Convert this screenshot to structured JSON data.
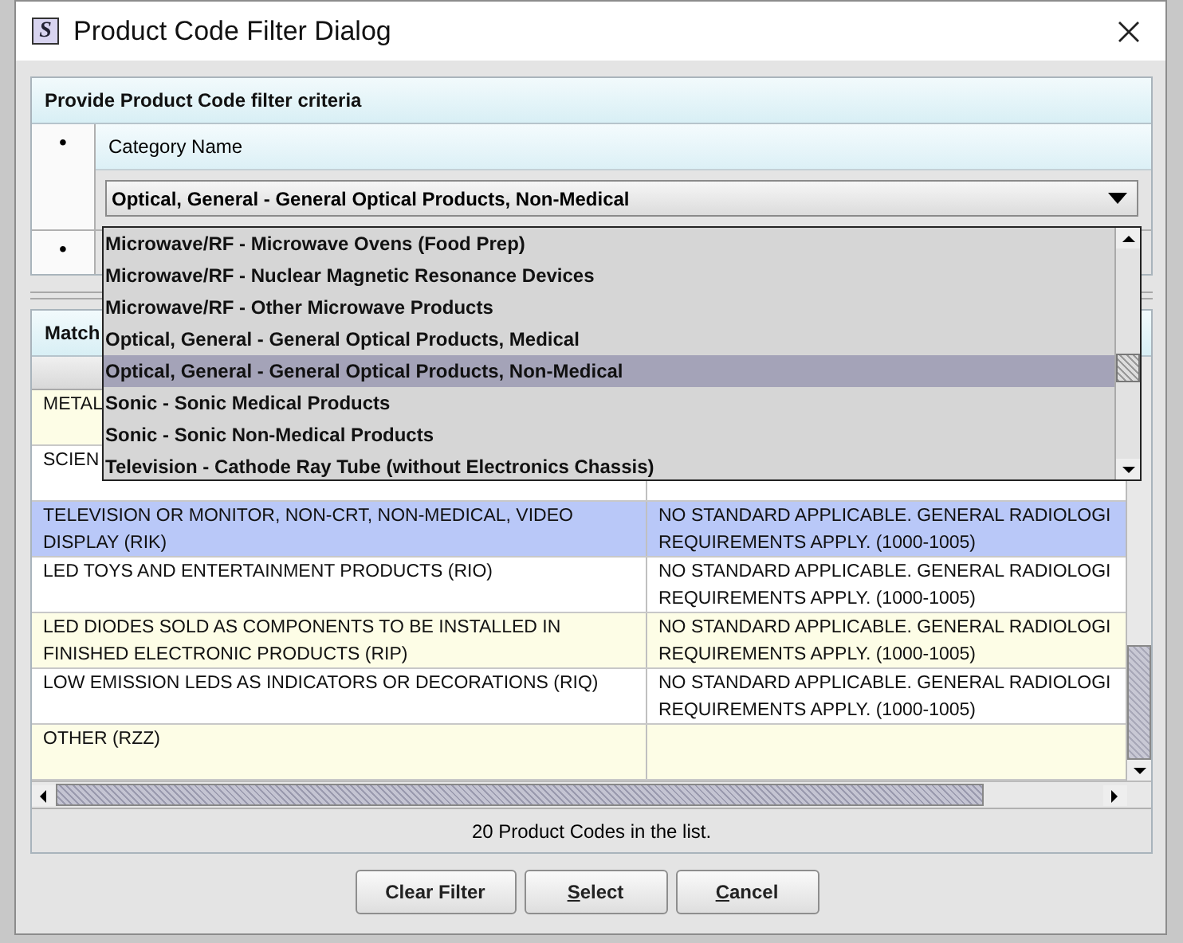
{
  "window": {
    "title": "Product Code Filter Dialog",
    "icon_letter": "S"
  },
  "criteria": {
    "title": "Provide Product Code filter criteria",
    "items": [
      {
        "bullet": "•",
        "label": "Category Name",
        "value": "Optical, General - General Optical Products, Non-Medical",
        "expanded": true,
        "options": [
          {
            "label": "Microwave/RF - Microwave Ovens (Food Prep)",
            "selected": false
          },
          {
            "label": "Microwave/RF - Nuclear Magnetic Resonance Devices",
            "selected": false
          },
          {
            "label": "Microwave/RF - Other Microwave Products",
            "selected": false
          },
          {
            "label": "Optical, General - General Optical Products, Medical",
            "selected": false
          },
          {
            "label": "Optical, General - General Optical Products, Non-Medical",
            "selected": true
          },
          {
            "label": "Sonic - Sonic Medical Products",
            "selected": false
          },
          {
            "label": "Sonic - Sonic Non-Medical Products",
            "selected": false
          },
          {
            "label": "Television - Cathode Ray Tube (without Electronics Chassis)",
            "selected": false
          }
        ]
      },
      {
        "bullet": "•"
      }
    ]
  },
  "matches": {
    "title": "Match",
    "rows": [
      {
        "selected": false,
        "cells": [
          {
            "lines": [
              "METAL"
            ]
          },
          {}
        ]
      },
      {
        "selected": false,
        "cells": [
          {
            "lines": [
              "SCIEN"
            ]
          },
          {}
        ]
      },
      {
        "selected": true,
        "cells": [
          {
            "lines": [
              "TELEVISION OR MONITOR, NON-CRT, NON-MEDICAL, VIDEO",
              "DISPLAY (RIK)"
            ]
          },
          {
            "lines": [
              "NO STANDARD APPLICABLE. GENERAL RADIOLOGI",
              "REQUIREMENTS APPLY. (1000-1005)"
            ]
          }
        ]
      },
      {
        "selected": false,
        "cells": [
          {
            "lines": [
              "LED TOYS AND ENTERTAINMENT PRODUCTS (RIO)"
            ]
          },
          {
            "lines": [
              "NO STANDARD APPLICABLE. GENERAL RADIOLOGI",
              "REQUIREMENTS APPLY. (1000-1005)"
            ]
          }
        ]
      },
      {
        "selected": false,
        "cells": [
          {
            "lines": [
              "LED DIODES SOLD AS COMPONENTS TO BE INSTALLED IN",
              "FINISHED ELECTRONIC PRODUCTS (RIP)"
            ]
          },
          {
            "lines": [
              "NO STANDARD APPLICABLE. GENERAL RADIOLOGI",
              "REQUIREMENTS APPLY. (1000-1005)"
            ]
          }
        ]
      },
      {
        "selected": false,
        "cells": [
          {
            "lines": [
              "LOW EMISSION LEDS AS INDICATORS OR DECORATIONS (RIQ)"
            ]
          },
          {
            "lines": [
              "NO STANDARD APPLICABLE. GENERAL RADIOLOGI",
              "REQUIREMENTS APPLY. (1000-1005)"
            ]
          }
        ]
      },
      {
        "selected": false,
        "cells": [
          {
            "lines": [
              "OTHER (RZZ)"
            ]
          },
          {}
        ]
      }
    ],
    "status": "20 Product Codes in the list."
  },
  "buttons": [
    {
      "label": "Clear Filter"
    },
    {
      "label": "Select",
      "first_letter_underlined": true
    },
    {
      "label": "Cancel",
      "first_letter_underlined": true
    }
  ]
}
